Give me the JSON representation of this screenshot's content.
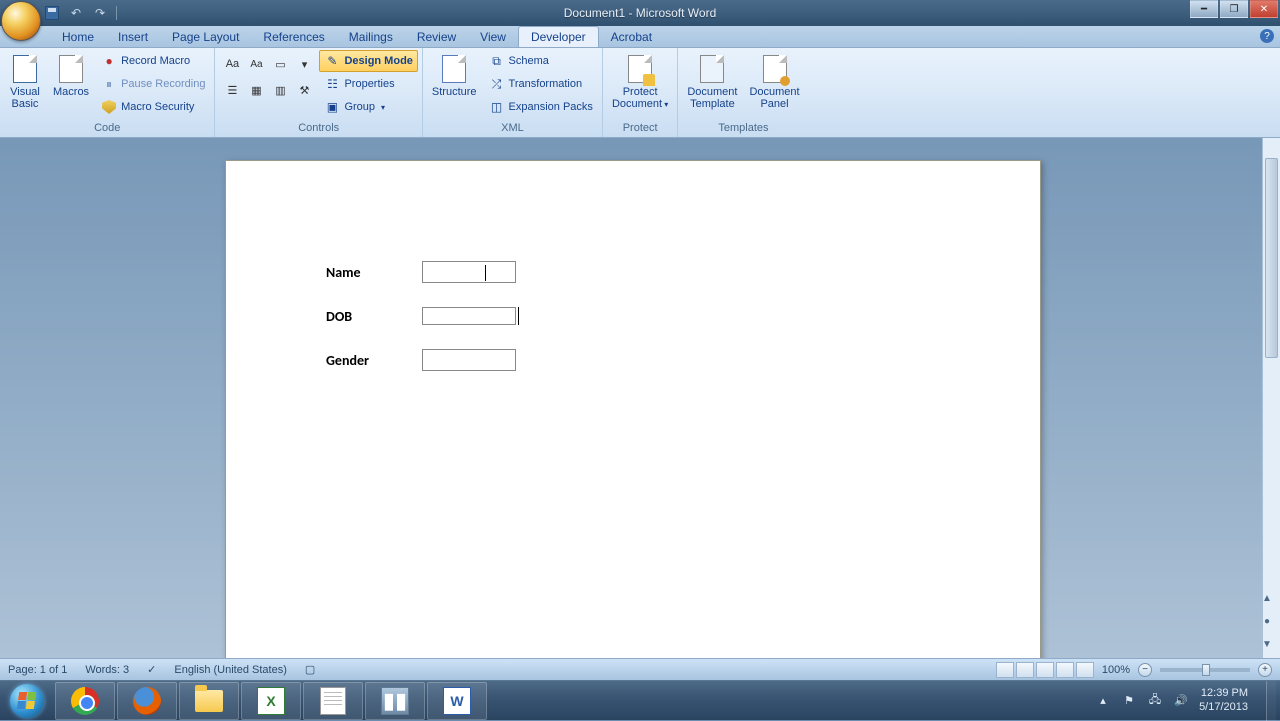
{
  "titlebar": {
    "title": "Document1 - Microsoft Word"
  },
  "qat": {
    "save": "Save",
    "undo": "Undo",
    "redo": "Redo"
  },
  "tabs": [
    "Home",
    "Insert",
    "Page Layout",
    "References",
    "Mailings",
    "Review",
    "View",
    "Developer",
    "Acrobat"
  ],
  "active_tab": "Developer",
  "ribbon": {
    "code": {
      "label": "Code",
      "visual_basic": "Visual\nBasic",
      "macros": "Macros",
      "record_macro": "Record Macro",
      "pause_recording": "Pause Recording",
      "macro_security": "Macro Security"
    },
    "controls": {
      "label": "Controls",
      "design_mode": "Design Mode",
      "properties": "Properties",
      "group": "Group"
    },
    "xml": {
      "label": "XML",
      "structure": "Structure",
      "schema": "Schema",
      "transformation": "Transformation",
      "expansion_packs": "Expansion Packs"
    },
    "protect": {
      "label": "Protect",
      "protect_document": "Protect\nDocument"
    },
    "templates": {
      "label": "Templates",
      "document_template": "Document\nTemplate",
      "document_panel": "Document\nPanel"
    }
  },
  "form": {
    "name_label": "Name",
    "dob_label": "DOB",
    "gender_label": "Gender"
  },
  "statusbar": {
    "page": "Page: 1 of 1",
    "words": "Words: 3",
    "language": "English (United States)",
    "zoom": "100%"
  },
  "tray": {
    "time": "12:39 PM",
    "date": "5/17/2013"
  }
}
